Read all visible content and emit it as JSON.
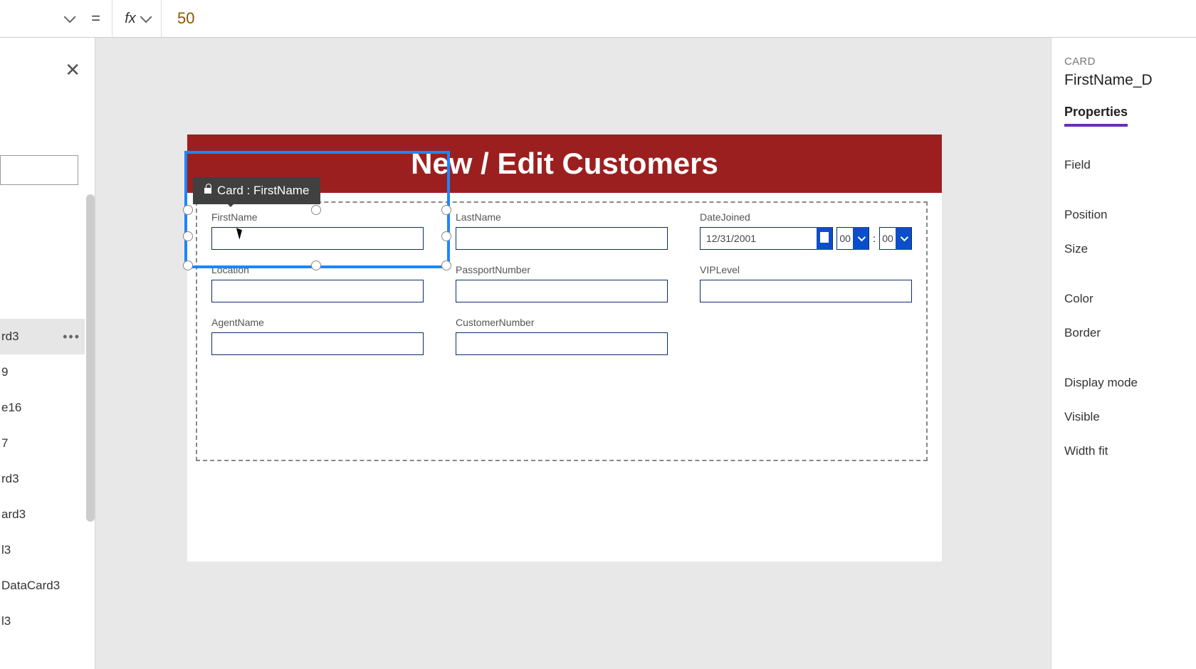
{
  "formula": {
    "value": "50",
    "equals": "="
  },
  "tree": {
    "items": [
      {
        "label": "rd3",
        "selected": true
      },
      {
        "label": "9"
      },
      {
        "label": "e16"
      },
      {
        "label": "7"
      },
      {
        "label": "rd3"
      },
      {
        "label": "ard3"
      },
      {
        "label": "l3"
      },
      {
        "label": "DataCard3"
      },
      {
        "label": "l3"
      }
    ]
  },
  "screen": {
    "title": "New / Edit Customers",
    "fields": {
      "firstName": "FirstName",
      "lastName": "LastName",
      "dateJoined": "DateJoined",
      "location": "Location",
      "passportNumber": "PassportNumber",
      "vipLevel": "VIPLevel",
      "agentName": "AgentName",
      "customerNumber": "CustomerNumber"
    },
    "dateValue": "12/31/2001",
    "hour": "00",
    "minute": "00",
    "colon": ":"
  },
  "selection": {
    "tooltip": "Card : FirstName"
  },
  "props": {
    "type": "CARD",
    "name": "FirstName_D",
    "tab": "Properties",
    "rows": {
      "field": "Field",
      "position": "Position",
      "size": "Size",
      "color": "Color",
      "border": "Border",
      "displayMode": "Display mode",
      "visible": "Visible",
      "widthFit": "Width fit"
    }
  }
}
